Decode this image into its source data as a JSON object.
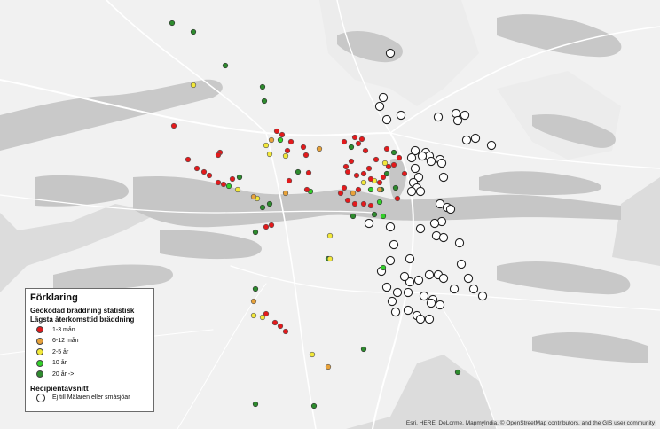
{
  "legend": {
    "title": "Förklaring",
    "layer_title": "Geokodad braddning statistisk",
    "field_title": "Lägsta återkomsttid bräddning",
    "classes": [
      {
        "label": "1-3 mån",
        "color": "#e31a1c"
      },
      {
        "label": "6-12 mån",
        "color": "#e8a23a"
      },
      {
        "label": "2-5 år",
        "color": "#f2e83a"
      },
      {
        "label": "10 år",
        "color": "#33d02a"
      },
      {
        "label": "20 år ->",
        "color": "#2e8b2e"
      }
    ],
    "section_title": "Recipientavsnitt",
    "section_item": "Ej till Mälaren eller småsjöar"
  },
  "attribution": "Esri, HERE, DeLorme, MapmyIndia, © OpenStreetMap contributors, and the GIS user community",
  "colors": {
    "background": "#dcdcdc",
    "land": "#f2f2f2",
    "water": "#c8c8c8",
    "roads": "#ffffff"
  },
  "points": {
    "red": [
      [
        196,
        142
      ],
      [
        212,
        180
      ],
      [
        222,
        190
      ],
      [
        230,
        194
      ],
      [
        236,
        198
      ],
      [
        246,
        206
      ],
      [
        248,
        172
      ],
      [
        246,
        175
      ],
      [
        252,
        208
      ],
      [
        262,
        202
      ],
      [
        300,
        256
      ],
      [
        306,
        254
      ],
      [
        312,
        148
      ],
      [
        318,
        152
      ],
      [
        324,
        170
      ],
      [
        326,
        204
      ],
      [
        328,
        160
      ],
      [
        342,
        166
      ],
      [
        345,
        175
      ],
      [
        348,
        195
      ],
      [
        346,
        214
      ],
      [
        388,
        160
      ],
      [
        390,
        188
      ],
      [
        396,
        182
      ],
      [
        400,
        155
      ],
      [
        404,
        162
      ],
      [
        408,
        157
      ],
      [
        412,
        170
      ],
      [
        402,
        198
      ],
      [
        410,
        196
      ],
      [
        416,
        190
      ],
      [
        418,
        202
      ],
      [
        410,
        230
      ],
      [
        418,
        232
      ],
      [
        424,
        180
      ],
      [
        428,
        206
      ],
      [
        432,
        200
      ],
      [
        436,
        168
      ],
      [
        438,
        188
      ],
      [
        444,
        186
      ],
      [
        448,
        224
      ],
      [
        450,
        178
      ],
      [
        456,
        196
      ],
      [
        300,
        354
      ],
      [
        310,
        364
      ],
      [
        316,
        368
      ],
      [
        322,
        374
      ],
      [
        384,
        218
      ],
      [
        388,
        212
      ],
      [
        392,
        226
      ],
      [
        400,
        230
      ],
      [
        392,
        194
      ],
      [
        404,
        214
      ]
    ],
    "orange": [
      [
        306,
        158
      ],
      [
        322,
        218
      ],
      [
        286,
        222
      ],
      [
        370,
        414
      ],
      [
        286,
        340
      ],
      [
        428,
        214
      ],
      [
        360,
        168
      ],
      [
        398,
        218
      ]
    ],
    "yellow": [
      [
        218,
        96
      ],
      [
        304,
        174
      ],
      [
        300,
        164
      ],
      [
        268,
        214
      ],
      [
        290,
        224
      ],
      [
        322,
        176
      ],
      [
        372,
        266
      ],
      [
        372,
        292
      ],
      [
        286,
        356
      ],
      [
        296,
        358
      ],
      [
        352,
        400
      ],
      [
        434,
        184
      ],
      [
        410,
        206
      ],
      [
        422,
        204
      ]
    ],
    "lightgreen": [
      [
        316,
        158
      ],
      [
        258,
        210
      ],
      [
        350,
        216
      ],
      [
        432,
        244
      ],
      [
        432,
        302
      ],
      [
        418,
        214
      ],
      [
        428,
        228
      ]
    ],
    "darkgreen": [
      [
        194,
        26
      ],
      [
        218,
        36
      ],
      [
        254,
        74
      ],
      [
        296,
        98
      ],
      [
        298,
        114
      ],
      [
        336,
        194
      ],
      [
        296,
        234
      ],
      [
        304,
        230
      ],
      [
        270,
        200
      ],
      [
        288,
        262
      ],
      [
        370,
        292
      ],
      [
        288,
        326
      ],
      [
        410,
        394
      ],
      [
        516,
        420
      ],
      [
        288,
        456
      ],
      [
        354,
        458
      ],
      [
        444,
        172
      ],
      [
        436,
        196
      ],
      [
        430,
        214
      ],
      [
        396,
        166
      ],
      [
        398,
        244
      ],
      [
        422,
        242
      ],
      [
        446,
        212
      ]
    ],
    "white": [
      [
        440,
        60
      ],
      [
        432,
        110
      ],
      [
        428,
        120
      ],
      [
        436,
        135
      ],
      [
        452,
        130
      ],
      [
        494,
        132
      ],
      [
        514,
        128
      ],
      [
        524,
        130
      ],
      [
        516,
        136
      ],
      [
        526,
        158
      ],
      [
        536,
        156
      ],
      [
        554,
        164
      ],
      [
        468,
        170
      ],
      [
        480,
        172
      ],
      [
        484,
        176
      ],
      [
        496,
        180
      ],
      [
        464,
        178
      ],
      [
        468,
        190
      ],
      [
        476,
        176
      ],
      [
        486,
        182
      ],
      [
        498,
        184
      ],
      [
        472,
        200
      ],
      [
        466,
        206
      ],
      [
        470,
        212
      ],
      [
        464,
        216
      ],
      [
        474,
        216
      ],
      [
        500,
        200
      ],
      [
        496,
        230
      ],
      [
        504,
        234
      ],
      [
        508,
        236
      ],
      [
        498,
        250
      ],
      [
        490,
        252
      ],
      [
        474,
        258
      ],
      [
        492,
        266
      ],
      [
        500,
        268
      ],
      [
        518,
        274
      ],
      [
        444,
        276
      ],
      [
        462,
        292
      ],
      [
        440,
        294
      ],
      [
        520,
        298
      ],
      [
        430,
        306
      ],
      [
        436,
        324
      ],
      [
        448,
        330
      ],
      [
        460,
        330
      ],
      [
        478,
        334
      ],
      [
        488,
        338
      ],
      [
        496,
        344
      ],
      [
        442,
        340
      ],
      [
        446,
        352
      ],
      [
        460,
        350
      ],
      [
        470,
        356
      ],
      [
        474,
        360
      ],
      [
        484,
        360
      ],
      [
        486,
        342
      ],
      [
        512,
        326
      ],
      [
        528,
        314
      ],
      [
        534,
        326
      ],
      [
        544,
        334
      ],
      [
        494,
        310
      ],
      [
        484,
        310
      ],
      [
        500,
        314
      ],
      [
        472,
        316
      ],
      [
        440,
        256
      ],
      [
        416,
        252
      ],
      [
        462,
        318
      ],
      [
        456,
        312
      ]
    ]
  }
}
